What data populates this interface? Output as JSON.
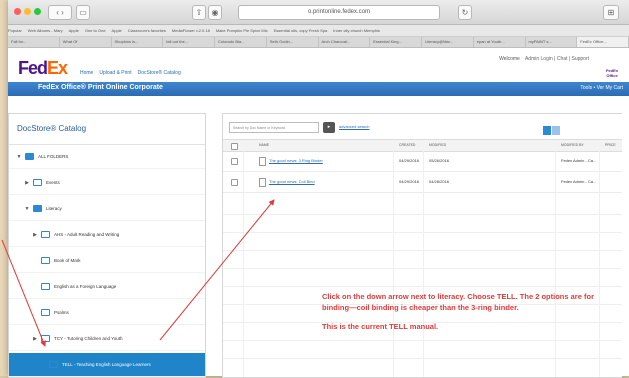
{
  "browser": {
    "url": "o.printonline.fedex.com",
    "favorites": [
      "Popular",
      "Web Albums - Mary",
      "Apple",
      "One to One",
      "Apple",
      "Classroom's favorites",
      "MediaFlower v.2.0.18",
      "Make Pumpkin Pie Spice Mix",
      "Essential oils, copy Fresh Spa",
      "Inner city church Memphis"
    ],
    "tabs": [
      "Fall for...",
      "What Of",
      "Shopkins is...",
      "fall out the...",
      "Colorado Bla...",
      "Seth Godin...",
      "Arch Charcoal...",
      "Essential King...",
      "Literacy@Mar...",
      "epan at Youth...",
      "myPAINT s...",
      "FedEx Office..."
    ],
    "active_tab": 11
  },
  "header": {
    "logo_fed": "Fed",
    "logo_ex": "Ex",
    "nav": [
      "Home",
      "Upload & Print",
      "DocStore® Catalog"
    ],
    "welcome": "Welcome",
    "account_links": "Admin Login | Chat | Support",
    "office_badge": "FedEx Office",
    "banner_title": "FedEx Office® Print Online Corporate",
    "banner_link": "Tools • Ver My Cart"
  },
  "catalog": {
    "title": "DocStore® Catalog",
    "tree": [
      {
        "label": "ALL FOLDERS",
        "indent": 0,
        "arrow": "▼",
        "filled": true
      },
      {
        "label": "Events",
        "indent": 1,
        "arrow": "▶",
        "filled": false
      },
      {
        "label": "Literacy",
        "indent": 1,
        "arrow": "▼",
        "filled": true
      },
      {
        "label": "AHS - Adult Reading and Writing",
        "indent": 2,
        "arrow": "▶",
        "filled": false
      },
      {
        "label": "Book of Mark",
        "indent": 2,
        "arrow": "",
        "filled": false
      },
      {
        "label": "English as a Foreign Language",
        "indent": 2,
        "arrow": "",
        "filled": false
      },
      {
        "label": "Psalms",
        "indent": 2,
        "arrow": "",
        "filled": false
      },
      {
        "label": "TCY - Tutoring Children and Youth",
        "indent": 2,
        "arrow": "▶",
        "filled": false
      },
      {
        "label": "TELL - Teaching English Language Learners",
        "indent": 3,
        "arrow": "",
        "filled": false,
        "selected": true
      }
    ]
  },
  "files": {
    "search_placeholder": "Search by Doc Name or Keyword",
    "go_label": "▸",
    "advanced_search": "advanced search",
    "columns": [
      "NAME",
      "CREATED",
      "MODIFIED",
      "MODIFIED BY",
      "PRICE"
    ],
    "rows": [
      {
        "name": "The good news: 3 Ring Binder",
        "created": "04/29/2016",
        "modified": "05/26/2016",
        "modified_by": "Fedex Admin - Ca..."
      },
      {
        "name": "The good news: Coil Bind",
        "created": "04/29/2016",
        "modified": "04/28/2016",
        "modified_by": "Fedex Admin - Ca..."
      }
    ]
  },
  "annotation": {
    "line1": "Click on the down arrow next to literacy. Choose TELL. The 2 options are for binding—coil binding is cheaper than the 3-ring binder.",
    "line2": "This is the current TELL manual.",
    "color": "#e03a3a"
  }
}
